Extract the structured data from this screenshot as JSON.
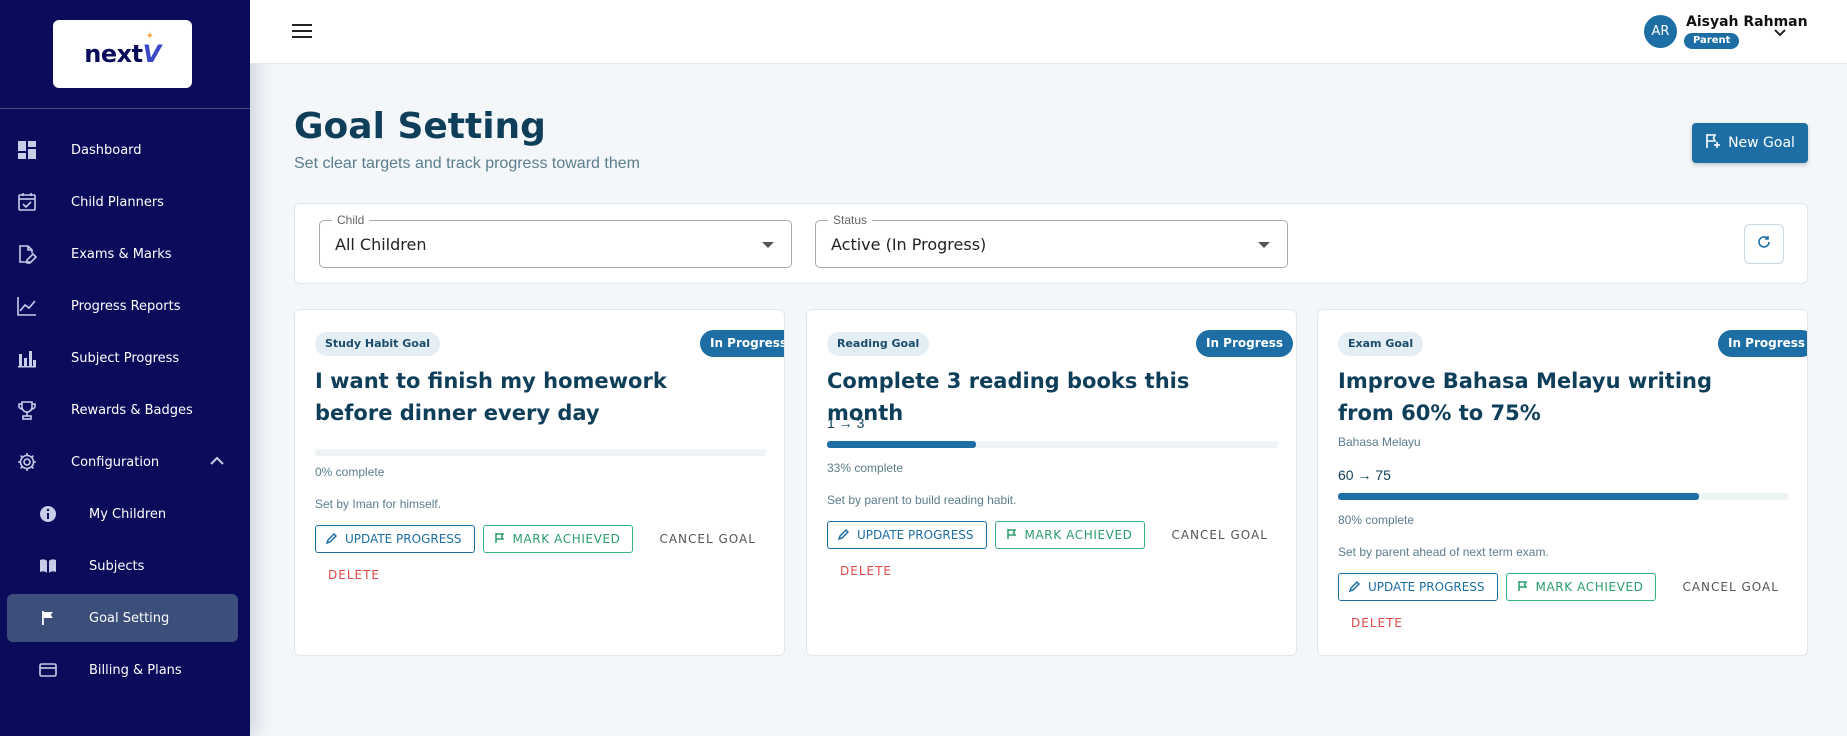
{
  "brand": {
    "logo_text": "next",
    "logo_accent": "V"
  },
  "sidebar": {
    "items": [
      {
        "label": "Dashboard",
        "icon": "dashboard-icon"
      },
      {
        "label": "Child Planners",
        "icon": "calendar-check-icon"
      },
      {
        "label": "Exams & Marks",
        "icon": "document-edit-icon"
      },
      {
        "label": "Progress Reports",
        "icon": "line-chart-icon"
      },
      {
        "label": "Subject Progress",
        "icon": "bar-chart-icon"
      },
      {
        "label": "Rewards & Badges",
        "icon": "trophy-icon"
      },
      {
        "label": "Configuration",
        "icon": "gear-icon"
      }
    ],
    "sub_items": [
      {
        "label": "My Children",
        "icon": "info-icon"
      },
      {
        "label": "Subjects",
        "icon": "book-icon"
      },
      {
        "label": "Goal Setting",
        "icon": "flag-icon"
      },
      {
        "label": "Billing & Plans",
        "icon": "card-icon"
      }
    ]
  },
  "user": {
    "initials": "AR",
    "name": "Aisyah Rahman",
    "role": "Parent"
  },
  "page": {
    "title": "Goal Setting",
    "subtitle": "Set clear targets and track progress toward them",
    "new_goal_label": "New Goal"
  },
  "filters": {
    "child": {
      "label": "Child",
      "value": "All Children"
    },
    "status": {
      "label": "Status",
      "value": "Active (In Progress)"
    }
  },
  "actions": {
    "update": "UPDATE PROGRESS",
    "achieve": "MARK ACHIEVED",
    "cancel": "CANCEL GOAL",
    "delete": "DELETE"
  },
  "goals": [
    {
      "type": "Study Habit Goal",
      "status": "In Progress",
      "title": "I want to finish my homework before dinner every day",
      "progress_percent": 0,
      "complete_text": "0% complete",
      "note": "Set by Iman for himself."
    },
    {
      "type": "Reading Goal",
      "status": "In Progress",
      "title": "Complete 3 reading books this month",
      "range": "1 → 3",
      "progress_percent": 33,
      "complete_text": "33% complete",
      "note": "Set by parent to build reading habit."
    },
    {
      "type": "Exam Goal",
      "status": "In Progress",
      "title": "Improve Bahasa Melayu writing from 60% to 75%",
      "subject": "Bahasa Melayu",
      "range": "60 → 75",
      "progress_percent": 80,
      "complete_text": "80% complete",
      "note": "Set by parent ahead of next term exam."
    }
  ],
  "colors": {
    "sidebar_bg": "#0b0b5c",
    "primary": "#1c6ea4",
    "success": "#2a9d6c",
    "danger": "#e04848"
  }
}
